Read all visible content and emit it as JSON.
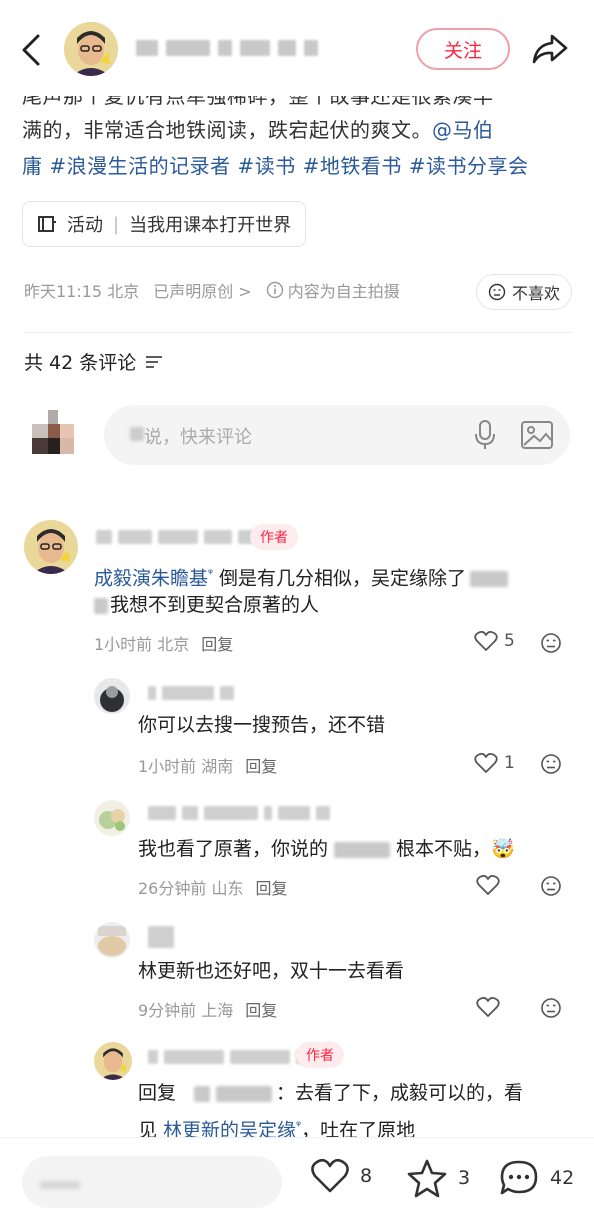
{
  "header": {
    "follow_label": "关注"
  },
  "post": {
    "line1": "尾声那个复仇有点牵强稀碎，整个故事还是很紧凑丰",
    "line2_plain": "满的，非常适合地铁阅读，跌宕起伏的爽文。",
    "mention": "@马伯",
    "line3_mention": "庸",
    "tags": [
      "#浪漫生活的记录者",
      "#读书",
      "#地铁看书",
      "#读书分享会"
    ]
  },
  "activity": {
    "label": "活动",
    "sep": "|",
    "title": "当我用课本打开世界"
  },
  "meta": {
    "time_location": "昨天11:15 北京",
    "original": "已声明原创 >",
    "info": "内容为自主拍摄",
    "dislike_label": "不喜欢"
  },
  "comments_header": {
    "label": "共 42 条评论"
  },
  "input": {
    "placeholder": "说，快来评论"
  },
  "comments": [
    {
      "badge": "作者",
      "text_link": "成毅演朱瞻基",
      "text_rest": " 倒是有几分相似，吴定缘除了",
      "text_line2": "我想不到更契合原著的人",
      "time": "1小时前 北京",
      "reply": "回复",
      "likes": "5"
    },
    {
      "text": "你可以去搜一搜预告，还不错",
      "time": "1小时前 湖南",
      "reply": "回复",
      "likes": "1"
    },
    {
      "text_a": "我也看了原著，你说的",
      "text_b": "根本不贴，",
      "emoji": "🤯",
      "time": "26分钟前 山东",
      "reply": "回复"
    },
    {
      "text": "林更新也还好吧，双十一去看看",
      "time": "9分钟前 上海",
      "reply": "回复"
    },
    {
      "badge": "作者",
      "text_a": "回复",
      "text_b": "：去看了下，成毅可以的，看",
      "text_c": "见 ",
      "text_link": "林更新的吴定缘",
      "text_d": "，吐在了原地"
    }
  ],
  "bottom": {
    "likes": "8",
    "stars": "3",
    "comments": "42"
  },
  "colors": {
    "accent": "#ff2442",
    "link": "#2a5a9a"
  }
}
